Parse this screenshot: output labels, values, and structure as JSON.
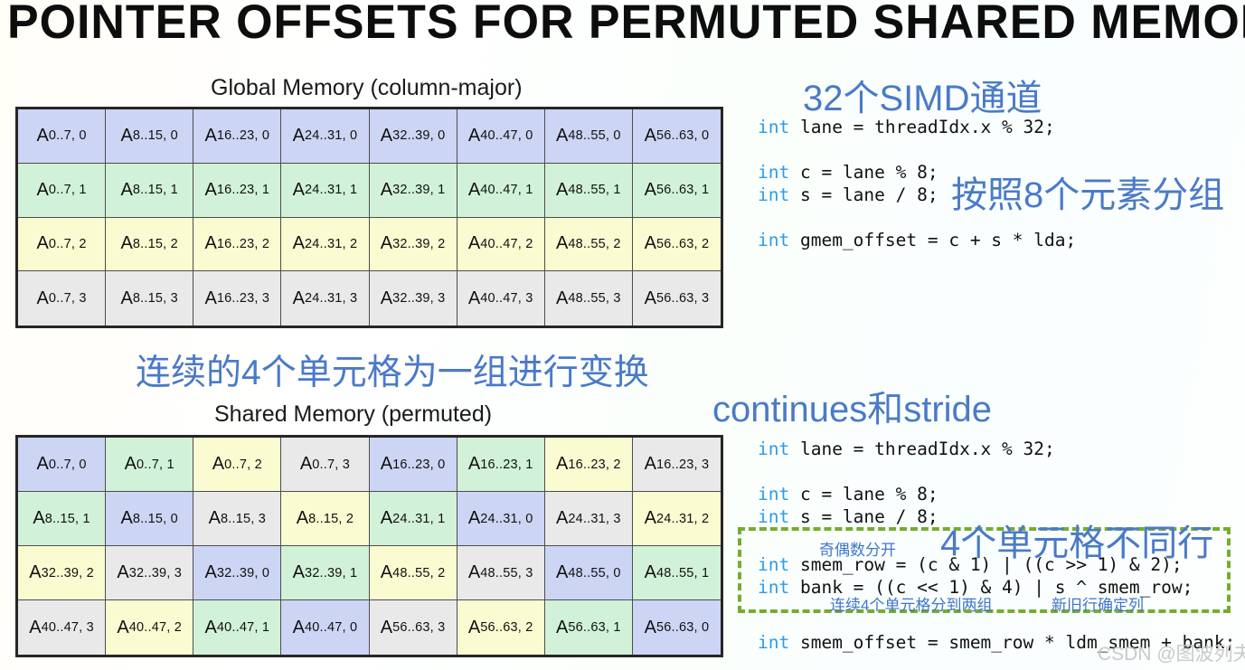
{
  "slide": {
    "title": "POINTER OFFSETS FOR PERMUTED SHARED MEMORY",
    "watermark": "CSDN @图波列夫",
    "accent_blue": "#4a7ac7",
    "keyword_blue": "#2d9ce8",
    "dashed_green": "#74ad2d"
  },
  "tables": {
    "global": {
      "caption": "Global Memory (column-major)",
      "rows": [
        [
          {
            "base": "A",
            "sub": "0..7, 0",
            "color": "blue"
          },
          {
            "base": "A",
            "sub": "8..15, 0",
            "color": "blue"
          },
          {
            "base": "A",
            "sub": "16..23, 0",
            "color": "blue"
          },
          {
            "base": "A",
            "sub": "24..31, 0",
            "color": "blue"
          },
          {
            "base": "A",
            "sub": "32..39, 0",
            "color": "blue"
          },
          {
            "base": "A",
            "sub": "40..47, 0",
            "color": "blue"
          },
          {
            "base": "A",
            "sub": "48..55, 0",
            "color": "blue"
          },
          {
            "base": "A",
            "sub": "56..63, 0",
            "color": "blue"
          }
        ],
        [
          {
            "base": "A",
            "sub": "0..7, 1",
            "color": "green"
          },
          {
            "base": "A",
            "sub": "8..15, 1",
            "color": "green"
          },
          {
            "base": "A",
            "sub": "16..23, 1",
            "color": "green"
          },
          {
            "base": "A",
            "sub": "24..31, 1",
            "color": "green"
          },
          {
            "base": "A",
            "sub": "32..39, 1",
            "color": "green"
          },
          {
            "base": "A",
            "sub": "40..47, 1",
            "color": "green"
          },
          {
            "base": "A",
            "sub": "48..55, 1",
            "color": "green"
          },
          {
            "base": "A",
            "sub": "56..63, 1",
            "color": "green"
          }
        ],
        [
          {
            "base": "A",
            "sub": "0..7, 2",
            "color": "yellow"
          },
          {
            "base": "A",
            "sub": "8..15, 2",
            "color": "yellow"
          },
          {
            "base": "A",
            "sub": "16..23, 2",
            "color": "yellow"
          },
          {
            "base": "A",
            "sub": "24..31, 2",
            "color": "yellow"
          },
          {
            "base": "A",
            "sub": "32..39, 2",
            "color": "yellow"
          },
          {
            "base": "A",
            "sub": "40..47, 2",
            "color": "yellow"
          },
          {
            "base": "A",
            "sub": "48..55, 2",
            "color": "yellow"
          },
          {
            "base": "A",
            "sub": "56..63, 2",
            "color": "yellow"
          }
        ],
        [
          {
            "base": "A",
            "sub": "0..7, 3",
            "color": "gray"
          },
          {
            "base": "A",
            "sub": "8..15, 3",
            "color": "gray"
          },
          {
            "base": "A",
            "sub": "16..23, 3",
            "color": "gray"
          },
          {
            "base": "A",
            "sub": "24..31, 3",
            "color": "gray"
          },
          {
            "base": "A",
            "sub": "32..39, 3",
            "color": "gray"
          },
          {
            "base": "A",
            "sub": "40..47, 3",
            "color": "gray"
          },
          {
            "base": "A",
            "sub": "48..55, 3",
            "color": "gray"
          },
          {
            "base": "A",
            "sub": "56..63, 3",
            "color": "gray"
          }
        ]
      ]
    },
    "shared": {
      "caption": "Shared Memory (permuted)",
      "rows": [
        [
          {
            "base": "A",
            "sub": "0..7, 0",
            "color": "blue"
          },
          {
            "base": "A",
            "sub": "0..7, 1",
            "color": "green"
          },
          {
            "base": "A",
            "sub": "0..7, 2",
            "color": "yellow"
          },
          {
            "base": "A",
            "sub": "0..7, 3",
            "color": "gray"
          },
          {
            "base": "A",
            "sub": "16..23, 0",
            "color": "blue"
          },
          {
            "base": "A",
            "sub": "16..23, 1",
            "color": "green"
          },
          {
            "base": "A",
            "sub": "16..23, 2",
            "color": "yellow"
          },
          {
            "base": "A",
            "sub": "16..23, 3",
            "color": "gray"
          }
        ],
        [
          {
            "base": "A",
            "sub": "8..15, 1",
            "color": "green"
          },
          {
            "base": "A",
            "sub": "8..15, 0",
            "color": "blue"
          },
          {
            "base": "A",
            "sub": "8..15, 3",
            "color": "gray"
          },
          {
            "base": "A",
            "sub": "8..15, 2",
            "color": "yellow"
          },
          {
            "base": "A",
            "sub": "24..31, 1",
            "color": "green"
          },
          {
            "base": "A",
            "sub": "24..31, 0",
            "color": "blue"
          },
          {
            "base": "A",
            "sub": "24..31, 3",
            "color": "gray"
          },
          {
            "base": "A",
            "sub": "24..31, 2",
            "color": "yellow"
          }
        ],
        [
          {
            "base": "A",
            "sub": "32..39, 2",
            "color": "yellow"
          },
          {
            "base": "A",
            "sub": "32..39, 3",
            "color": "gray"
          },
          {
            "base": "A",
            "sub": "32..39, 0",
            "color": "blue"
          },
          {
            "base": "A",
            "sub": "32..39, 1",
            "color": "green"
          },
          {
            "base": "A",
            "sub": "48..55, 2",
            "color": "yellow"
          },
          {
            "base": "A",
            "sub": "48..55, 3",
            "color": "gray"
          },
          {
            "base": "A",
            "sub": "48..55, 0",
            "color": "blue"
          },
          {
            "base": "A",
            "sub": "48..55, 1",
            "color": "green"
          }
        ],
        [
          {
            "base": "A",
            "sub": "40..47, 3",
            "color": "gray"
          },
          {
            "base": "A",
            "sub": "40..47, 2",
            "color": "yellow"
          },
          {
            "base": "A",
            "sub": "40..47, 1",
            "color": "green"
          },
          {
            "base": "A",
            "sub": "40..47, 0",
            "color": "blue"
          },
          {
            "base": "A",
            "sub": "56..63, 3",
            "color": "gray"
          },
          {
            "base": "A",
            "sub": "56..63, 2",
            "color": "yellow"
          },
          {
            "base": "A",
            "sub": "56..63, 1",
            "color": "green"
          },
          {
            "base": "A",
            "sub": "56..63, 0",
            "color": "blue"
          }
        ]
      ]
    }
  },
  "annotations": {
    "simd_lanes": "32个SIMD通道",
    "group_by_8": "按照8个元素分组",
    "transform_group_of_4": "连续的4个单元格为一组进行变换",
    "continues_and_stride": "continues和stride",
    "four_cells_diff_rows": "4个单元格不同行",
    "odd_even_split": "奇偶数分开",
    "four_cells_two_groups": "连续4个单元格分到两组",
    "new_old_row_determines_col": "新旧行确定列"
  },
  "code": {
    "top": [
      {
        "kw": "int",
        "rest": " lane = threadIdx.x % 32;"
      },
      {
        "kw": "",
        "rest": ""
      },
      {
        "kw": "int",
        "rest": " c = lane % 8;"
      },
      {
        "kw": "int",
        "rest": " s = lane / 8;"
      },
      {
        "kw": "",
        "rest": ""
      },
      {
        "kw": "int",
        "rest": " gmem_offset = c + s * lda;"
      }
    ],
    "mid": [
      {
        "kw": "int",
        "rest": " lane = threadIdx.x % 32;"
      },
      {
        "kw": "",
        "rest": ""
      },
      {
        "kw": "int",
        "rest": " c = lane % 8;"
      },
      {
        "kw": "int",
        "rest": " s = lane / 8;"
      }
    ],
    "boxed": [
      {
        "kw": "int",
        "rest": " smem_row = (c & 1) | ((c >> 1) & 2);"
      },
      {
        "kw": "int",
        "rest": " bank = ((c << 1) & 4) | s ^ smem_row;"
      }
    ],
    "bottom": [
      {
        "kw": "int",
        "rest": " smem_offset = smem_row * ldm_smem + bank;"
      }
    ]
  }
}
